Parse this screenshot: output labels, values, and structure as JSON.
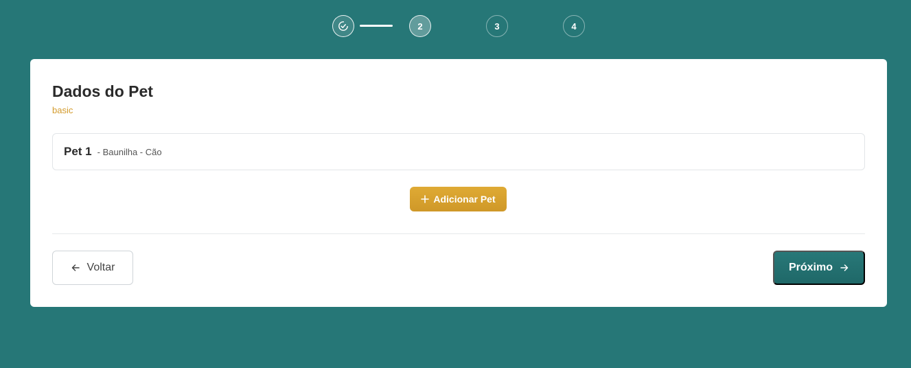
{
  "stepper": {
    "steps": [
      {
        "label": "",
        "state": "done",
        "icon": "check-circle-icon"
      },
      {
        "label": "2",
        "state": "active"
      },
      {
        "label": "3",
        "state": "pending"
      },
      {
        "label": "4",
        "state": "pending"
      }
    ]
  },
  "card": {
    "title": "Dados do Pet",
    "subtitle": "basic",
    "pets": [
      {
        "name": "Pet 1",
        "detail": "- Baunilha - Cão"
      }
    ],
    "add_pet_label": "Adicionar Pet",
    "back_label": "Voltar",
    "next_label": "Próximo"
  },
  "colors": {
    "background": "#267777",
    "accent": "#d39a2b",
    "primary": "#217070"
  }
}
